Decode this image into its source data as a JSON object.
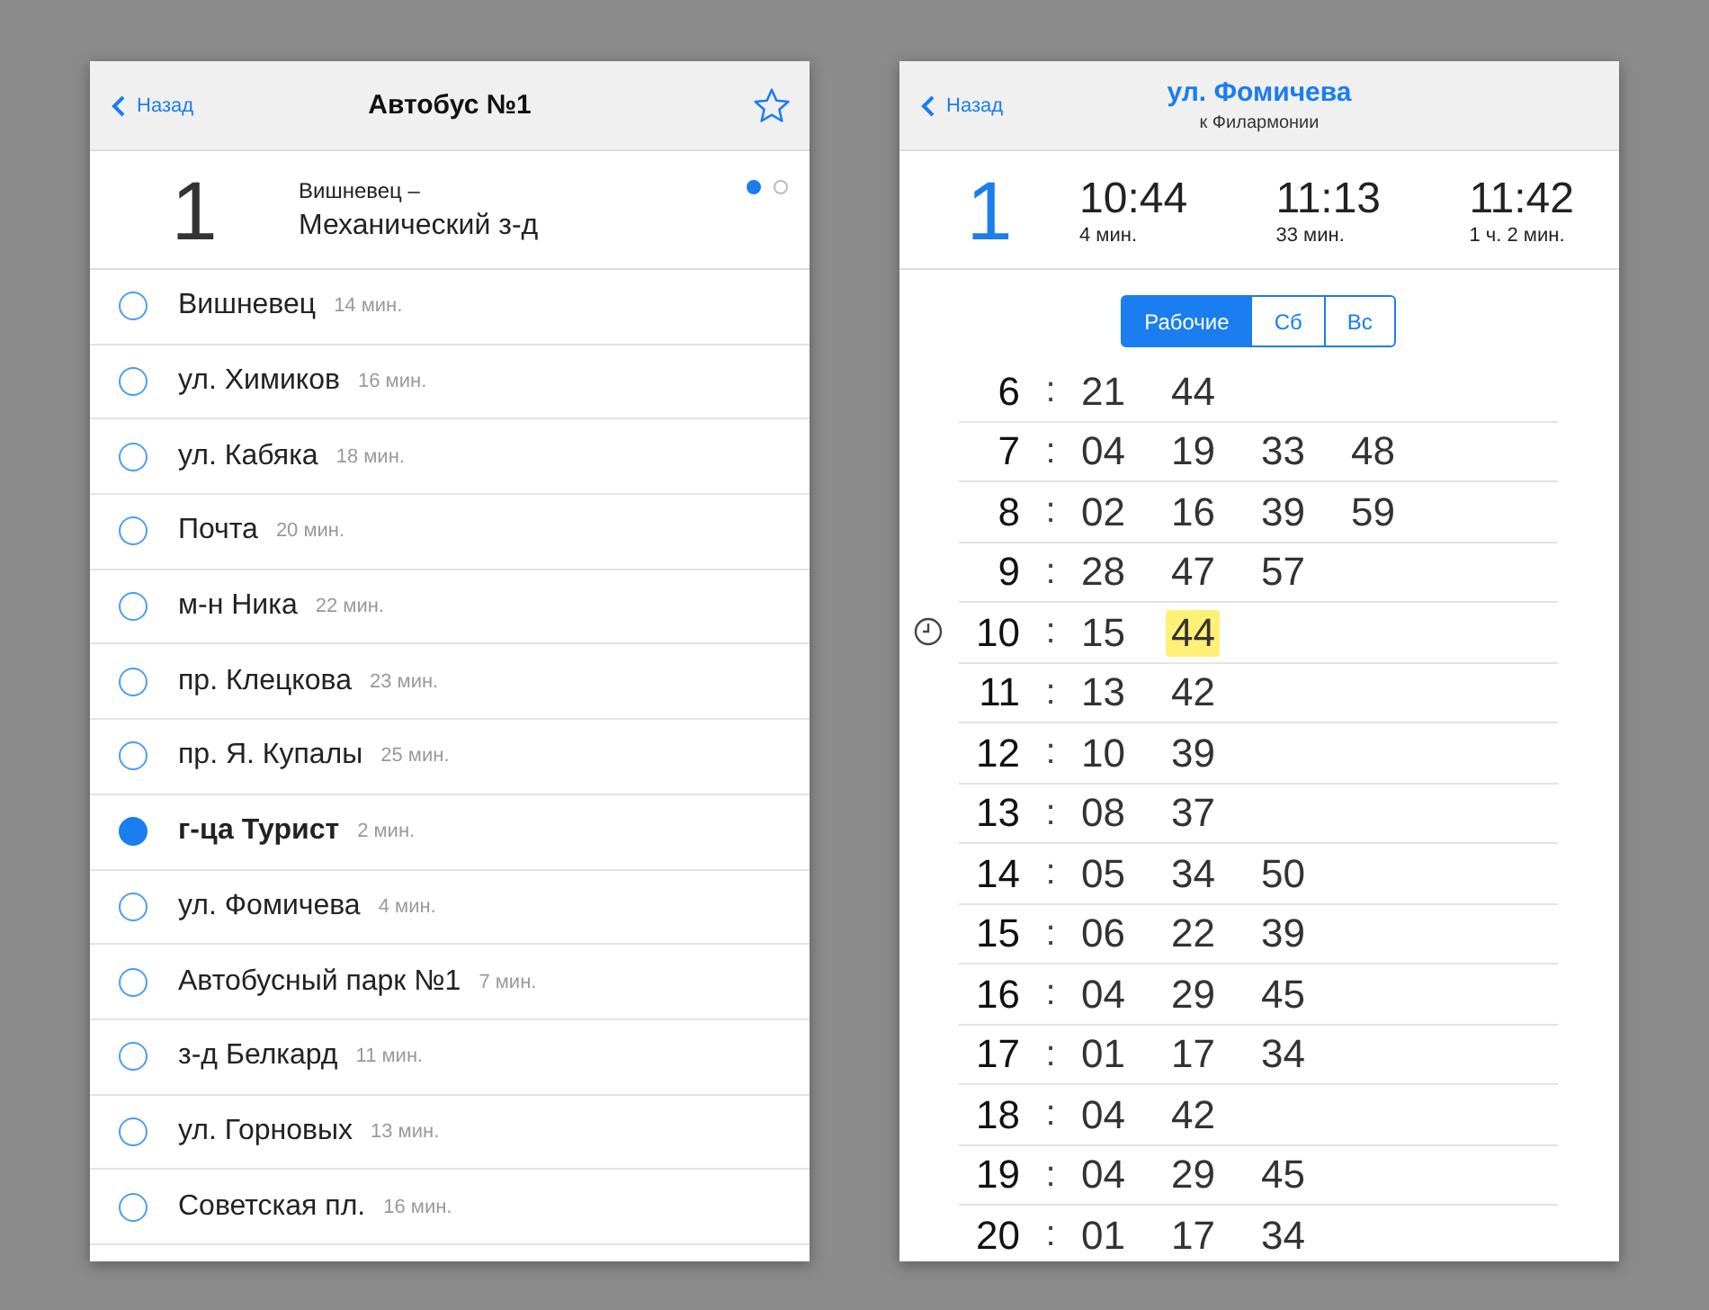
{
  "route_screen": {
    "back": "Назад",
    "title": "Автобус №1",
    "favorite": false,
    "route_number": "1",
    "from": "Вишневец  –",
    "to": "Механический з-д",
    "directions": [
      {
        "selected": true
      },
      {
        "selected": false
      }
    ],
    "stops": [
      {
        "name": "Вишневец",
        "time": "14 мин.",
        "selected": false
      },
      {
        "name": "ул. Химиков",
        "time": "16 мин.",
        "selected": false
      },
      {
        "name": "ул. Кабяка",
        "time": "18 мин.",
        "selected": false
      },
      {
        "name": "Почта",
        "time": "20 мин.",
        "selected": false
      },
      {
        "name": "м-н Ника",
        "time": "22 мин.",
        "selected": false
      },
      {
        "name": "пр. Клецкова",
        "time": "23 мин.",
        "selected": false
      },
      {
        "name": "пр. Я. Купалы",
        "time": "25 мин.",
        "selected": false
      },
      {
        "name": "г-ца Турист",
        "time": "2 мин.",
        "selected": true
      },
      {
        "name": "ул. Фомичева",
        "time": "4 мин.",
        "selected": false
      },
      {
        "name": "Автобусный парк №1",
        "time": "7 мин.",
        "selected": false
      },
      {
        "name": "з-д Белкард",
        "time": "11 мин.",
        "selected": false
      },
      {
        "name": "ул. Горновых",
        "time": "13 мин.",
        "selected": false
      },
      {
        "name": "Советская пл.",
        "time": "16 мин.",
        "selected": false
      }
    ]
  },
  "stop_screen": {
    "back": "Назад",
    "title": "ул. Фомичева",
    "subtitle": "к Филармонии",
    "route_number": "1",
    "next_departures": [
      {
        "time": "10:44",
        "wait": "4 мин."
      },
      {
        "time": "11:13",
        "wait": "33 мин."
      },
      {
        "time": "11:42",
        "wait": "1 ч. 2 мин."
      }
    ],
    "day_tabs": [
      {
        "label": "Рабочие",
        "selected": true
      },
      {
        "label": "Сб",
        "selected": false
      },
      {
        "label": "Вс",
        "selected": false
      }
    ],
    "schedule": [
      {
        "hour": "6",
        "separator": ":",
        "current": false,
        "minutes": [
          {
            "value": "21",
            "highlighted": false
          },
          {
            "value": "44",
            "highlighted": false
          }
        ]
      },
      {
        "hour": "7",
        "separator": ":",
        "current": false,
        "minutes": [
          {
            "value": "04",
            "highlighted": false
          },
          {
            "value": "19",
            "highlighted": false
          },
          {
            "value": "33",
            "highlighted": false
          },
          {
            "value": "48",
            "highlighted": false
          }
        ]
      },
      {
        "hour": "8",
        "separator": ":",
        "current": false,
        "minutes": [
          {
            "value": "02",
            "highlighted": false
          },
          {
            "value": "16",
            "highlighted": false
          },
          {
            "value": "39",
            "highlighted": false
          },
          {
            "value": "59",
            "highlighted": false
          }
        ]
      },
      {
        "hour": "9",
        "separator": ":",
        "current": false,
        "minutes": [
          {
            "value": "28",
            "highlighted": false
          },
          {
            "value": "47",
            "highlighted": false
          },
          {
            "value": "57",
            "highlighted": false
          }
        ]
      },
      {
        "hour": "10",
        "separator": ":",
        "current": true,
        "minutes": [
          {
            "value": "15",
            "highlighted": false
          },
          {
            "value": "44",
            "highlighted": true
          }
        ]
      },
      {
        "hour": "11",
        "separator": ":",
        "current": false,
        "minutes": [
          {
            "value": "13",
            "highlighted": false
          },
          {
            "value": "42",
            "highlighted": false
          }
        ]
      },
      {
        "hour": "12",
        "separator": ":",
        "current": false,
        "minutes": [
          {
            "value": "10",
            "highlighted": false
          },
          {
            "value": "39",
            "highlighted": false
          }
        ]
      },
      {
        "hour": "13",
        "separator": ":",
        "current": false,
        "minutes": [
          {
            "value": "08",
            "highlighted": false
          },
          {
            "value": "37",
            "highlighted": false
          }
        ]
      },
      {
        "hour": "14",
        "separator": ":",
        "current": false,
        "minutes": [
          {
            "value": "05",
            "highlighted": false
          },
          {
            "value": "34",
            "highlighted": false
          },
          {
            "value": "50",
            "highlighted": false
          }
        ]
      },
      {
        "hour": "15",
        "separator": ":",
        "current": false,
        "minutes": [
          {
            "value": "06",
            "highlighted": false
          },
          {
            "value": "22",
            "highlighted": false
          },
          {
            "value": "39",
            "highlighted": false
          }
        ]
      },
      {
        "hour": "16",
        "separator": ":",
        "current": false,
        "minutes": [
          {
            "value": "04",
            "highlighted": false
          },
          {
            "value": "29",
            "highlighted": false
          },
          {
            "value": "45",
            "highlighted": false
          }
        ]
      },
      {
        "hour": "17",
        "separator": ":",
        "current": false,
        "minutes": [
          {
            "value": "01",
            "highlighted": false
          },
          {
            "value": "17",
            "highlighted": false
          },
          {
            "value": "34",
            "highlighted": false
          }
        ]
      },
      {
        "hour": "18",
        "separator": ":",
        "current": false,
        "minutes": [
          {
            "value": "04",
            "highlighted": false
          },
          {
            "value": "42",
            "highlighted": false
          }
        ]
      },
      {
        "hour": "19",
        "separator": ":",
        "current": false,
        "minutes": [
          {
            "value": "04",
            "highlighted": false
          },
          {
            "value": "29",
            "highlighted": false
          },
          {
            "value": "45",
            "highlighted": false
          }
        ]
      },
      {
        "hour": "20",
        "separator": ":",
        "current": false,
        "minutes": [
          {
            "value": "01",
            "highlighted": false
          },
          {
            "value": "17",
            "highlighted": false
          },
          {
            "value": "34",
            "highlighted": false
          }
        ]
      }
    ]
  }
}
